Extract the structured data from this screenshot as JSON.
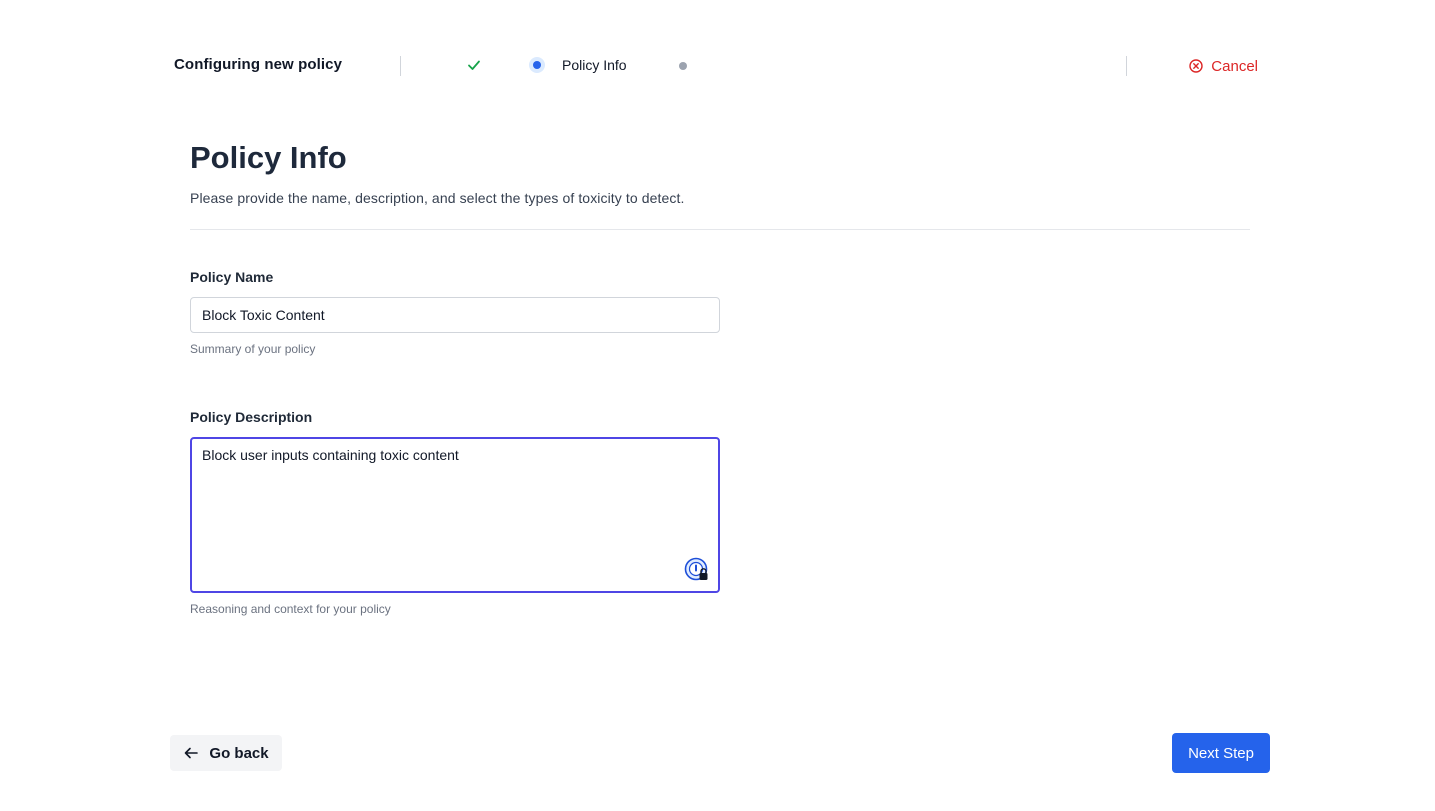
{
  "header": {
    "title": "Configuring new policy",
    "steps": [
      {
        "state": "completed",
        "icon": "check-icon"
      },
      {
        "state": "current",
        "label": "Policy Info"
      },
      {
        "state": "upcoming"
      }
    ],
    "cancel_label": "Cancel",
    "cancel_icon": "x-circle-icon"
  },
  "main": {
    "title": "Policy Info",
    "subtitle": "Please provide the name, description, and select the types of toxicity to detect.",
    "policy_name": {
      "label": "Policy Name",
      "value": "Block Toxic Content",
      "help": "Summary of your policy"
    },
    "policy_description": {
      "label": "Policy Description",
      "value": "Block user inputs containing toxic content",
      "help": "Reasoning and context for your policy"
    }
  },
  "footer": {
    "back_label": "Go back",
    "next_label": "Next Step"
  },
  "colors": {
    "primary": "#2563eb",
    "danger": "#dc2626",
    "focus_border": "#4f46e5",
    "success": "#16a34a"
  }
}
